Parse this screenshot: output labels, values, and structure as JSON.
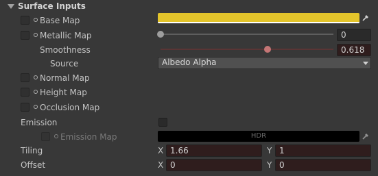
{
  "section": {
    "title": "Surface Inputs"
  },
  "base_map": {
    "label": "Base Map",
    "color": "#e3c42b"
  },
  "metallic_map": {
    "label": "Metallic Map",
    "value": "0",
    "slider_fraction": 0.0
  },
  "smoothness": {
    "label": "Smoothness",
    "value": "0.618",
    "slider_fraction": 0.618
  },
  "source": {
    "label": "Source",
    "selected": "Albedo Alpha"
  },
  "normal_map": {
    "label": "Normal Map"
  },
  "height_map": {
    "label": "Height Map"
  },
  "occlusion_map": {
    "label": "Occlusion Map"
  },
  "emission": {
    "label": "Emission",
    "checked": false
  },
  "emission_map": {
    "label": "Emission Map",
    "hdr_label": "HDR",
    "color": "#000000"
  },
  "tiling": {
    "label": "Tiling",
    "x_label": "X",
    "x": "1.66",
    "y_label": "Y",
    "y": "1"
  },
  "offset": {
    "label": "Offset",
    "x_label": "X",
    "x": "0",
    "y_label": "Y",
    "y": "0"
  },
  "icons": {
    "foldout": "triangle-down-icon",
    "eyedropper": "eyedropper-icon",
    "picker": "object-picker-icon",
    "dropdown": "chevron-down-icon"
  }
}
